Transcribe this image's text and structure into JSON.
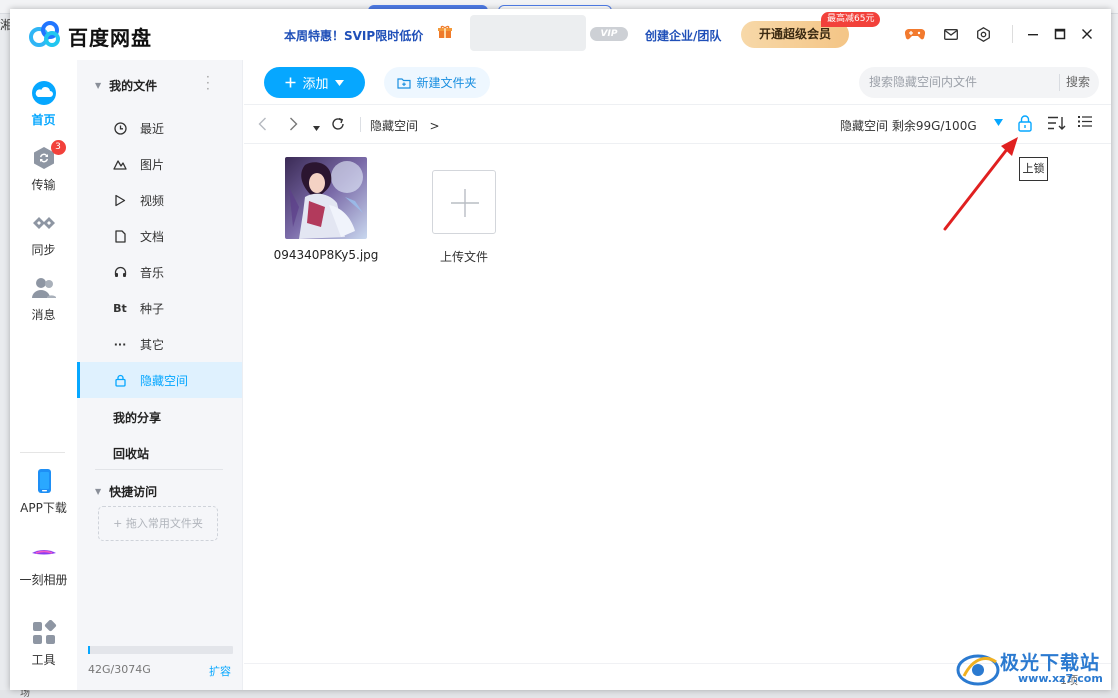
{
  "background": {
    "left_text": "湘",
    "bottom_left_text": "场"
  },
  "app": {
    "name": "百度网盘",
    "promo": "本周特惠！SVIP限时低价",
    "vip_badge": "VIP",
    "corp_link": "创建企业/团队",
    "open_vip": "开通超级会员",
    "discount_tag": "最高减65元",
    "icons": [
      "game-icon",
      "mail-icon",
      "settings-icon",
      "minimize-icon",
      "maximize-icon",
      "close-icon"
    ]
  },
  "leftnav": {
    "items": [
      {
        "label": "首页",
        "icon": "cloud-icon",
        "active": true
      },
      {
        "label": "传输",
        "icon": "transfer-icon",
        "badge": "3"
      },
      {
        "label": "同步",
        "icon": "sync-icon"
      },
      {
        "label": "消息",
        "icon": "contacts-icon"
      },
      {
        "label": "APP下载",
        "icon": "phone-icon"
      },
      {
        "label": "一刻相册",
        "icon": "album-icon"
      },
      {
        "label": "工具",
        "icon": "tools-icon"
      }
    ]
  },
  "sidebar": {
    "my_files": "我的文件",
    "items": [
      {
        "label": "最近",
        "icon": "clock-icon"
      },
      {
        "label": "图片",
        "icon": "image-icon"
      },
      {
        "label": "视频",
        "icon": "video-icon"
      },
      {
        "label": "文档",
        "icon": "document-icon"
      },
      {
        "label": "音乐",
        "icon": "headphones-icon"
      },
      {
        "label": "种子",
        "icon": "bt-icon",
        "glyph": "Bt"
      },
      {
        "label": "其它",
        "icon": "more-icon",
        "glyph": "···"
      },
      {
        "label": "隐藏空间",
        "icon": "lock-icon",
        "active": true
      }
    ],
    "my_share": "我的分享",
    "recycle": "回收站",
    "quick_access": "快捷访问",
    "drag_hint": "+ 拖入常用文件夹",
    "storage_text": "42G/3074G",
    "storage_fraction": 0.0137,
    "expand": "扩容"
  },
  "toolbar": {
    "add_label": "添加",
    "new_folder_label": "新建文件夹",
    "search_placeholder": "搜索隐藏空间内文件",
    "search_button": "搜索"
  },
  "navbar": {
    "breadcrumb": "隐藏空间",
    "breadcrumb_sep": ">",
    "quota": "隐藏空间  剩余99G/100G",
    "lock_tooltip": "上锁"
  },
  "files": [
    {
      "name": "094340P8Ky5.jpg",
      "type": "image"
    }
  ],
  "upload": {
    "label": "上传文件"
  },
  "footer": {
    "count": "1项"
  },
  "watermark": {
    "text": "极光下载站",
    "url": "www.xz7.com"
  },
  "colors": {
    "accent": "#06a7ff",
    "link_blue": "#1f4fb8",
    "vip_gold": "#f4c586",
    "badge_red": "#f2413b",
    "arrow_red": "#e02020"
  }
}
